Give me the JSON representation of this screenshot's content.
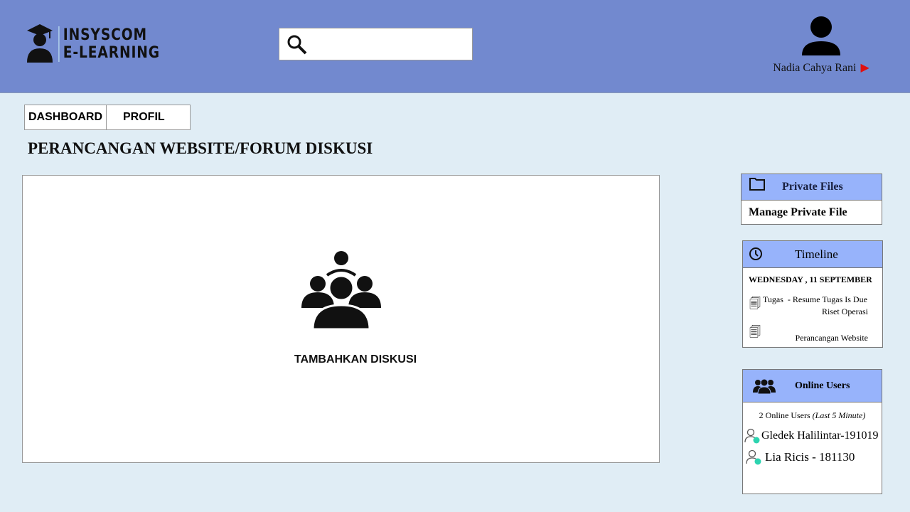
{
  "header": {
    "logo_line1": "INSYSCOM",
    "logo_line2": "E-LEARNING",
    "search_placeholder": "",
    "user_name": "Nadia Cahya Rani"
  },
  "tabs": [
    {
      "label": "DASHBOARD"
    },
    {
      "label": "PROFIL"
    }
  ],
  "page_title": "PERANCANGAN WEBSITE/FORUM DISKUSI",
  "main": {
    "add_label": "TAMBAHKAN DISKUSI"
  },
  "private_files": {
    "title": "Private Files",
    "link": "Manage Private File"
  },
  "timeline": {
    "title": "Timeline",
    "date": "WEDNESDAY , 11 SEPTEMBER",
    "items": [
      {
        "type": "Tugas",
        "text": "- Resume Tugas Is Due",
        "course": "Riset Operasi"
      },
      {
        "course": "Perancangan Website"
      }
    ]
  },
  "online_users": {
    "title": "Online Users",
    "count_text": "2 Online Users",
    "period": "(Last 5 Minute)",
    "users": [
      "Gledek Halilintar-191019",
      "Lia Ricis - 181130"
    ]
  },
  "colors": {
    "header": "#7289cf",
    "panel_header": "#97b3fb",
    "background": "#e0edf5",
    "online": "#2dd4b0"
  }
}
